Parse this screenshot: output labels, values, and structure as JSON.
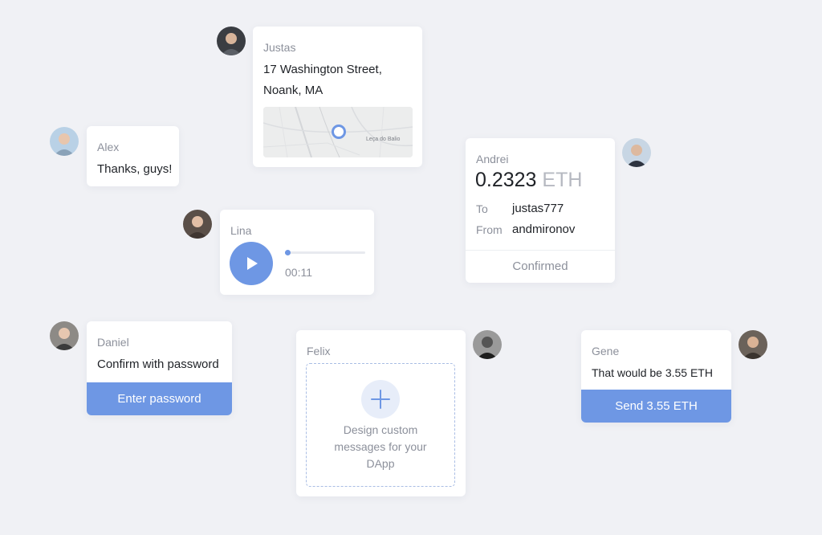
{
  "colors": {
    "background": "#f0f1f5",
    "accent": "#6e97e4",
    "muted": "#8c909b"
  },
  "justas": {
    "name": "Justas",
    "address_line1": "17 Washington Street,",
    "address_line2": "Noank, MA",
    "map_label": "Leça do Balio",
    "map_icon": "location-pin-icon"
  },
  "alex": {
    "name": "Alex",
    "message": "Thanks, guys!"
  },
  "andrei": {
    "name": "Andrei",
    "amount": "0.2323",
    "currency": "ETH",
    "to_label": "To",
    "to_value": "justas777",
    "from_label": "From",
    "from_value": "andmironov",
    "status": "Confirmed"
  },
  "lina": {
    "name": "Lina",
    "time": "00:11",
    "progress": 0.03,
    "play_icon": "play-icon"
  },
  "daniel": {
    "name": "Daniel",
    "message": "Confirm with password",
    "button": "Enter password"
  },
  "felix": {
    "name": "Felix",
    "add_icon": "plus-icon",
    "description_line1": "Design custom",
    "description_line2": "messages for your",
    "description_line3": "DApp"
  },
  "gene": {
    "name": "Gene",
    "message": "That would be 3.55 ETH",
    "button": "Send 3.55 ETH"
  }
}
